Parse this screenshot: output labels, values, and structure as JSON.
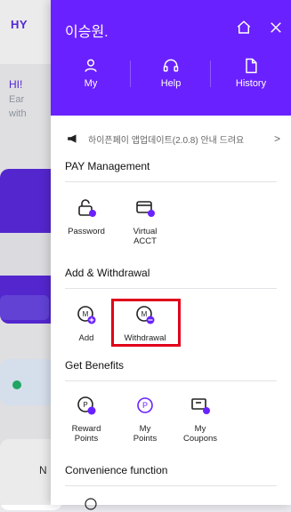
{
  "background": {
    "logo": "HY",
    "greeting": "HI!",
    "sub_line_1": "Ear",
    "sub_line_2": "with",
    "card_text": "N"
  },
  "drawer": {
    "user_name": "이승원.",
    "quick_menu": [
      {
        "label": "My",
        "icon": "person-icon"
      },
      {
        "label": "Help",
        "icon": "headset-icon"
      },
      {
        "label": "History",
        "icon": "document-icon"
      }
    ],
    "notice": {
      "text": "하이픈페이 앱업데이트(2.0.8) 안내 드려요",
      "icon": "megaphone-icon",
      "arrow": ">"
    },
    "sections": [
      {
        "title": "PAY Management",
        "items": [
          {
            "label_line1": "Password",
            "label_line2": "",
            "icon": "lock-icon"
          },
          {
            "label_line1": "Virtual",
            "label_line2": "ACCT",
            "icon": "card-icon"
          }
        ]
      },
      {
        "title": "Add & Withdrawal",
        "items": [
          {
            "label_line1": "Add",
            "label_line2": "",
            "icon": "coin-plus-icon"
          },
          {
            "label_line1": "Withdrawal",
            "label_line2": "",
            "icon": "coin-minus-icon"
          }
        ]
      },
      {
        "title": "Get Benefits",
        "items": [
          {
            "label_line1": "Reward",
            "label_line2": "Points",
            "icon": "reward-icon"
          },
          {
            "label_line1": "My",
            "label_line2": "Points",
            "icon": "points-icon"
          },
          {
            "label_line1": "My",
            "label_line2": "Coupons",
            "icon": "coupon-icon"
          }
        ]
      },
      {
        "title": "Convenience function",
        "items": []
      }
    ]
  },
  "colors": {
    "drawer_header": "#6a21ff",
    "highlight": "#e0001a"
  }
}
